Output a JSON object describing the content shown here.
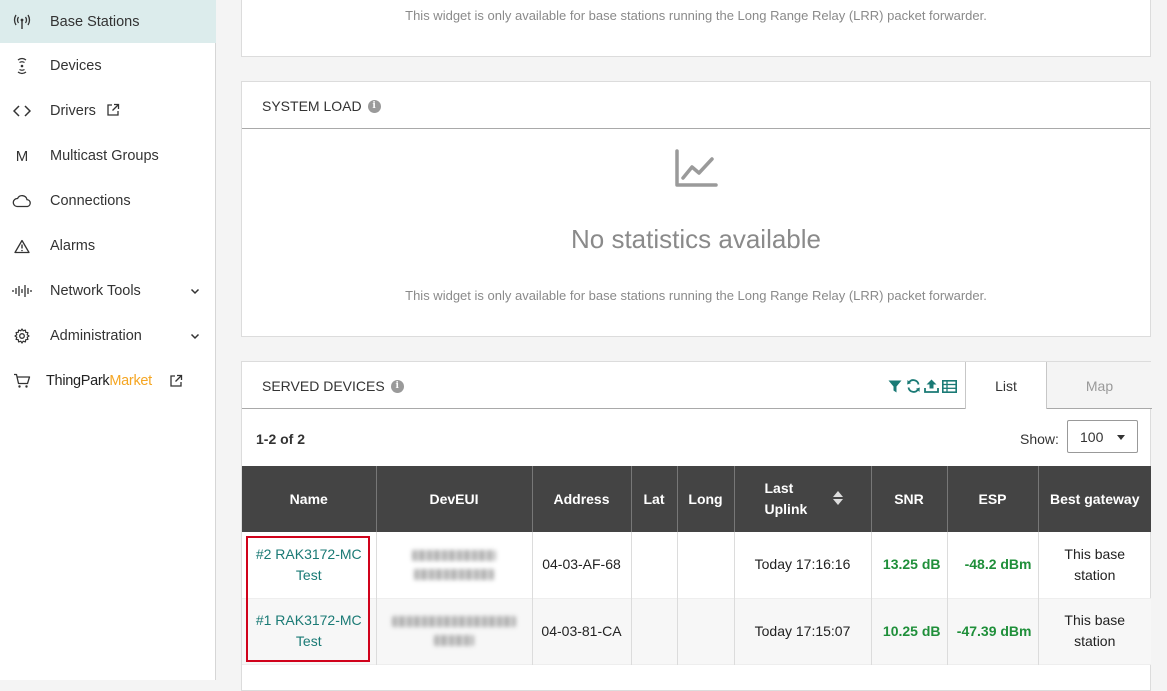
{
  "sidebar": {
    "items": [
      {
        "label": "Base Stations",
        "icon": "antenna-icon",
        "active": true
      },
      {
        "label": "Devices",
        "icon": "device-signal-icon"
      },
      {
        "label": "Drivers",
        "icon": "code-icon",
        "external": true
      },
      {
        "label": "Multicast Groups",
        "icon": "multicast-m-icon"
      },
      {
        "label": "Connections",
        "icon": "cloud-icon"
      },
      {
        "label": "Alarms",
        "icon": "warning-triangle-icon"
      },
      {
        "label": "Network Tools",
        "icon": "waveform-icon",
        "expandable": true
      },
      {
        "label": "Administration",
        "icon": "gear-icon",
        "expandable": true
      }
    ],
    "market": {
      "part1": "ThingPark",
      "part2": "Market",
      "icon": "cart-icon",
      "accent": "#f5a623"
    }
  },
  "top_panel": {
    "note": "This widget is only available for base stations running the Long Range Relay (LRR) packet forwarder."
  },
  "system_load": {
    "title": "SYSTEM LOAD",
    "empty_title": "No statistics available",
    "note": "This widget is only available for base stations running the Long Range Relay (LRR) packet forwarder."
  },
  "served_devices": {
    "title": "SERVED DEVICES",
    "tabs": {
      "list": "List",
      "map": "Map"
    },
    "toolbar_icons": [
      "filter-icon",
      "refresh-icon",
      "upload-icon",
      "table-columns-icon"
    ],
    "count": "1-2 of 2",
    "show_label": "Show:",
    "show_value": "100",
    "columns": [
      "Name",
      "DevEUI",
      "Address",
      "Lat",
      "Long",
      "Last Uplink",
      "SNR",
      "ESP",
      "Best gateway"
    ],
    "rows": [
      {
        "name": "#2 RAK3172-MC Test",
        "address": "04-03-AF-68",
        "lat": "",
        "long": "",
        "last_uplink": "Today 17:16:16",
        "snr": "13.25 dB",
        "esp": "-48.2 dBm",
        "best_gateway": "This base station"
      },
      {
        "name": "#1 RAK3172-MC Test",
        "address": "04-03-81-CA",
        "lat": "",
        "long": "",
        "last_uplink": "Today 17:15:07",
        "snr": "10.25 dB",
        "esp": "-47.39 dBm",
        "best_gateway": "This base station"
      }
    ]
  },
  "colors": {
    "accent": "#1a7a75",
    "positive": "#1f8f3a",
    "highlight": "#d0021b",
    "header_dark": "#444444"
  }
}
